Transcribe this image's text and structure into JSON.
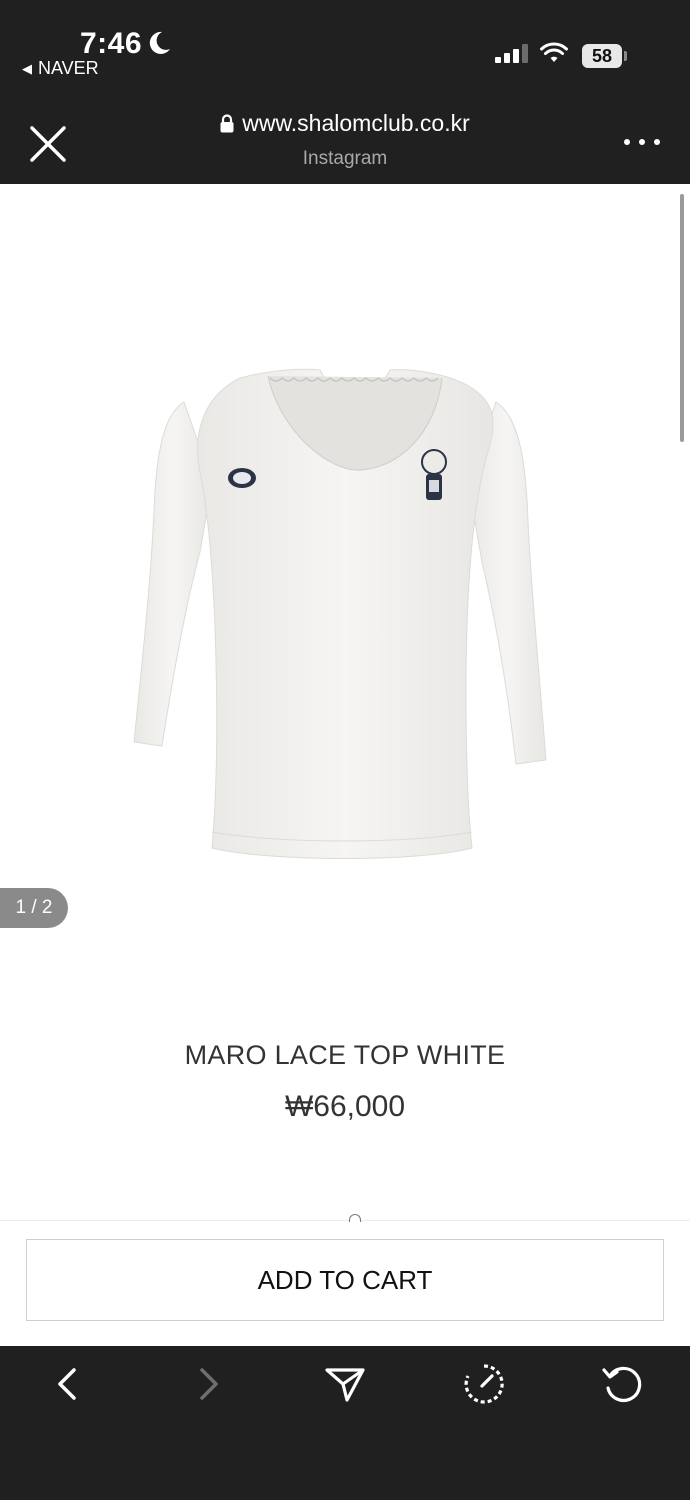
{
  "status_bar": {
    "time": "7:46",
    "back_app": "NAVER",
    "battery": "58"
  },
  "browser": {
    "url": "www.shalomclub.co.kr",
    "subtitle": "Instagram",
    "icons": [
      "close-icon",
      "lock-icon",
      "more-icon"
    ]
  },
  "product": {
    "slide_counter": "1 / 2",
    "name": "MARO LACE TOP WHITE",
    "price": "₩66,000",
    "color": "#f4f3f0"
  },
  "cart": {
    "add_label": "ADD TO CART"
  },
  "toolbar": {
    "icons": [
      "back-icon",
      "forward-icon",
      "share-icon",
      "speed-icon",
      "refresh-icon"
    ]
  }
}
